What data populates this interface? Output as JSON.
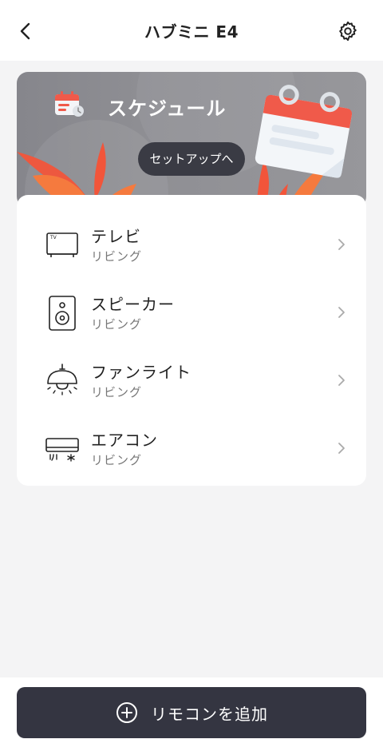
{
  "header": {
    "title": "ハブミニ E4",
    "back_icon": "chevron-left-icon",
    "settings_icon": "gear-icon"
  },
  "banner": {
    "title": "スケジュール",
    "button_label": "セットアップへ",
    "icon": "calendar-icon",
    "colors": {
      "accent": "#f2553a",
      "button": "#3a3b44"
    }
  },
  "devices": [
    {
      "name": "テレビ",
      "room": "リビング",
      "icon": "tv-icon"
    },
    {
      "name": "スピーカー",
      "room": "リビング",
      "icon": "speaker-icon"
    },
    {
      "name": "ファンライト",
      "room": "リビング",
      "icon": "fan-light-icon"
    },
    {
      "name": "エアコン",
      "room": "リビング",
      "icon": "air-conditioner-icon"
    }
  ],
  "bottom": {
    "add_label": "リモコンを追加",
    "add_icon": "plus-circle-icon",
    "color": "#343541"
  }
}
